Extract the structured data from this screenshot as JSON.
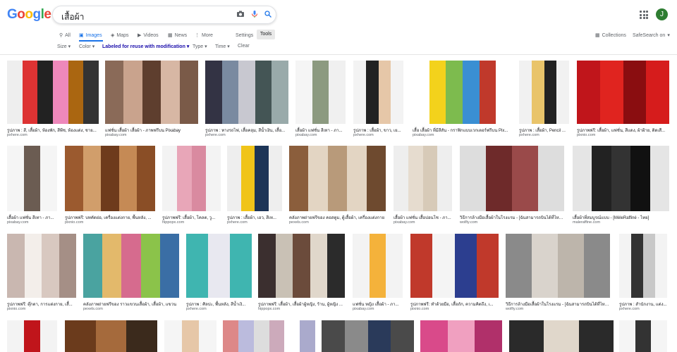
{
  "logo": {
    "letters": [
      "G",
      "o",
      "o",
      "g",
      "l",
      "e"
    ],
    "colors": [
      "#4285f4",
      "#ea4335",
      "#fbbc05",
      "#4285f4",
      "#34a853",
      "#ea4335"
    ]
  },
  "search": {
    "query": "เสื้อผ้า"
  },
  "user": {
    "initial": "J",
    "color": "#2e7d32"
  },
  "nav": {
    "all": "All",
    "images": "Images",
    "maps": "Maps",
    "videos": "Videos",
    "news": "News",
    "more": "More",
    "settings": "Settings",
    "tools": "Tools",
    "collections": "Collections",
    "safesearch": "SafeSearch on"
  },
  "filters": {
    "size": "Size",
    "color": "Color",
    "license": "Labeled for reuse with modification",
    "type": "Type",
    "time": "Time",
    "clear": "Clear"
  },
  "results": [
    {
      "caption": "รูปภาพ : สี, เสื้อผ้า, ห้องพัก, สีพีช, ห้องแต่ง, ชาย...",
      "source": "pxhere.com",
      "colors": [
        "#eee",
        "#d33",
        "#222",
        "#e8b",
        "#a61",
        "#333"
      ]
    },
    {
      "caption": "แฟชั่น เสื้อผ้า เสื้อผ้า - ภาพฟรีบน Pixabay",
      "source": "pixabay.com",
      "colors": [
        "#8a6a58",
        "#c9a38d",
        "#5e3e2e",
        "#d7b7a4",
        "#7a5a48"
      ]
    },
    {
      "caption": "รูปภาพ : ทางรถไฟ, เสื้อคลุม, สีน้ำเงิน, เสื้อ...",
      "source": "pxhere.com",
      "colors": [
        "#334",
        "#7a8aa0",
        "#c8c8d0",
        "#455",
        "#9aa"
      ]
    },
    {
      "caption": "เสื้อผ้า แฟชั่น สีเทา - ภา...",
      "source": "pixabay.com",
      "colors": [
        "#f5f5f5",
        "#8c9a80",
        "#f0f0f0"
      ]
    },
    {
      "caption": "รูปภาพ : เสื้อผ้า, ขาว, เย...",
      "source": "pxhere.com",
      "colors": [
        "#f3f3f3",
        "#222",
        "#e6c7a8",
        "#f3f3f3"
      ]
    },
    {
      "caption": "เสื้อ เสื้อผ้า ที่มีสีสัน - กราฟิกแบบเวกเตอร์ฟรีบน Pix...",
      "source": "pixabay.com",
      "colors": [
        "#fff",
        "#f3d21c",
        "#7dbb4e",
        "#3a8fd3",
        "#c0392b",
        "#fff"
      ]
    },
    {
      "caption": "รูปภาพ : เสื้อผ้า, Pencil ...",
      "source": "pxhere.com",
      "colors": [
        "#f1f1f1",
        "#e9c46a",
        "#222",
        "#f1f1f1"
      ]
    },
    {
      "caption": "รูปภาพฟรี: เสื้อผ้า, แฟชั่น, สีแดง, ผ้าฝ้าย, ติดเสื...",
      "source": "pixnio.com",
      "colors": [
        "#c0151b",
        "#e0241f",
        "#8a0d10",
        "#d61c1c"
      ]
    },
    {
      "caption": "เสื้อผ้า แฟชั่น สีเทา - ภา...",
      "source": "pixabay.com",
      "colors": [
        "#f5f5f5",
        "#6b5c52",
        "#f5f5f5"
      ]
    },
    {
      "caption": "รูปภาพฟรี: บทคัดย่อ, เครื่องแต่งกาย, พื้นหลัง, ...",
      "source": "pixnio.com",
      "colors": [
        "#9b5a2f",
        "#d19e6b",
        "#6e3b1c",
        "#c58a55",
        "#8a4e26"
      ]
    },
    {
      "caption": "รูปภาพฟรี: เสื้อผ้า, โคลต, วู...",
      "source": "hippopx.com",
      "colors": [
        "#f3f3f3",
        "#e8a6b8",
        "#d98aa0",
        "#f3f3f3"
      ]
    },
    {
      "caption": "รูปภาพ : เสื้อผ้า, เอว, สีเท...",
      "source": "pxhere.com",
      "colors": [
        "#eee",
        "#f0c419",
        "#1d3557",
        "#eee"
      ]
    },
    {
      "caption": "คลังภาพถ่ายฟรีของ คอสตูม, ตู้เสื้อผ้า, เครื่องแต่งกาย",
      "source": "pexels.com",
      "colors": [
        "#8b5e3c",
        "#e3d5c3",
        "#b89a7a",
        "#e3d5c3",
        "#6e4a2f"
      ]
    },
    {
      "caption": "เสื้อผ้า แฟชั่น เสื้อปอนโช - ภา...",
      "source": "pixabay.com",
      "colors": [
        "#eee",
        "#e6dccf",
        "#d7cab8",
        "#eee"
      ]
    },
    {
      "caption": "วิธีการล้างมือเสื้อผ้าในโรงแรม - [ฉันสามารถบินได้ที่ไหน?]",
      "source": "wolfiy.com",
      "colors": [
        "#ddd",
        "#6e2a2a",
        "#9a4a4a",
        "#ddd"
      ]
    },
    {
      "caption": "เสื้อผ้าที่สมบูรณ์แบบ - [MèleRaffiné - ไทย]",
      "source": "maleraffine.com",
      "colors": [
        "#e5e5e5",
        "#222",
        "#333",
        "#111",
        "#e5e5e5"
      ]
    },
    {
      "caption": "รูปภาพฟรี: ตุ๊กตา, การแต่งกาย, เสื้...",
      "source": "pixnio.com",
      "colors": [
        "#c9b7b0",
        "#f3eeea",
        "#d8c8c0",
        "#a58f86"
      ]
    },
    {
      "caption": "คลังภาพถ่ายฟรีของ ราวแขวนเสื้อผ้า, เสื้อผ้า, แขวน",
      "source": "pexels.com",
      "colors": [
        "#4aa3a0",
        "#e3b96b",
        "#d66b8e",
        "#8bc34a",
        "#3a6ea5"
      ]
    },
    {
      "caption": "รูปภาพ : ศิลปะ, พื้นหลัง, สีน้ำเงิ...",
      "source": "pxhere.com",
      "colors": [
        "#3fb5b0",
        "#e8e8f0",
        "#3fb5b0"
      ]
    },
    {
      "caption": "รูปภาพฟรี: เสื้อผ้า, เสื้อผ้าผู้หญิง, ร้าน, ผู้หญิง ...",
      "source": "hippopx.com",
      "colors": [
        "#3b2f2f",
        "#c9c1b5",
        "#6b4b3b",
        "#e0d7cb",
        "#2b2b2b"
      ]
    },
    {
      "caption": "แฟชั่น หญิง เสื้อผ้า - ภา...",
      "source": "pixabay.com",
      "colors": [
        "#f3f3f3",
        "#f4b23b",
        "#f3f3f3"
      ]
    },
    {
      "caption": "รูปภาพฟรี: ทำด้วยมือ, เสื้อถัก, ความคิดถึง, เ...",
      "source": "pixnio.com",
      "colors": [
        "#c0392b",
        "#f4f4f4",
        "#2c3e8f",
        "#c0392b"
      ]
    },
    {
      "caption": "วิธีการล้างมือเสื้อผ้าในโรงแรม - [ฉันสามารถบินได้ที่ไหน?]",
      "source": "wolfiy.com",
      "colors": [
        "#8a8a8a",
        "#d9d3cc",
        "#bdb5ab",
        "#8a8a8a"
      ]
    },
    {
      "caption": "รูปภาพ : สำนักงาน, แต่ง...",
      "source": "pxhere.com",
      "colors": [
        "#f3f3f3",
        "#333",
        "#c8c8c8",
        "#f3f3f3"
      ]
    },
    {
      "caption": "",
      "source": "",
      "colors": [
        "#f3f3f3",
        "#c0151b",
        "#f3f3f3"
      ]
    },
    {
      "caption": "",
      "source": "",
      "colors": [
        "#6b3b1c",
        "#a56a3c",
        "#3b2a1c"
      ]
    },
    {
      "caption": "",
      "source": "",
      "colors": [
        "#f5f5f5",
        "#e6c7a8",
        "#f5f5f5"
      ]
    },
    {
      "caption": "",
      "source": "",
      "colors": [
        "#d88",
        "#bbd",
        "#ddd",
        "#cab",
        "#fff",
        "#aac"
      ]
    },
    {
      "caption": "",
      "source": "",
      "colors": [
        "#4a4a4a",
        "#8a8a8a",
        "#2a3a5a",
        "#4a4a4a"
      ]
    },
    {
      "caption": "",
      "source": "",
      "colors": [
        "#d94a8a",
        "#f0a0c0",
        "#b0306a"
      ]
    },
    {
      "caption": "",
      "source": "",
      "colors": [
        "#2a2a2a",
        "#e0d7cb",
        "#2a2a2a"
      ]
    },
    {
      "caption": "",
      "source": "",
      "colors": [
        "#f5f5f5",
        "#333",
        "#f5f5f5"
      ]
    }
  ]
}
